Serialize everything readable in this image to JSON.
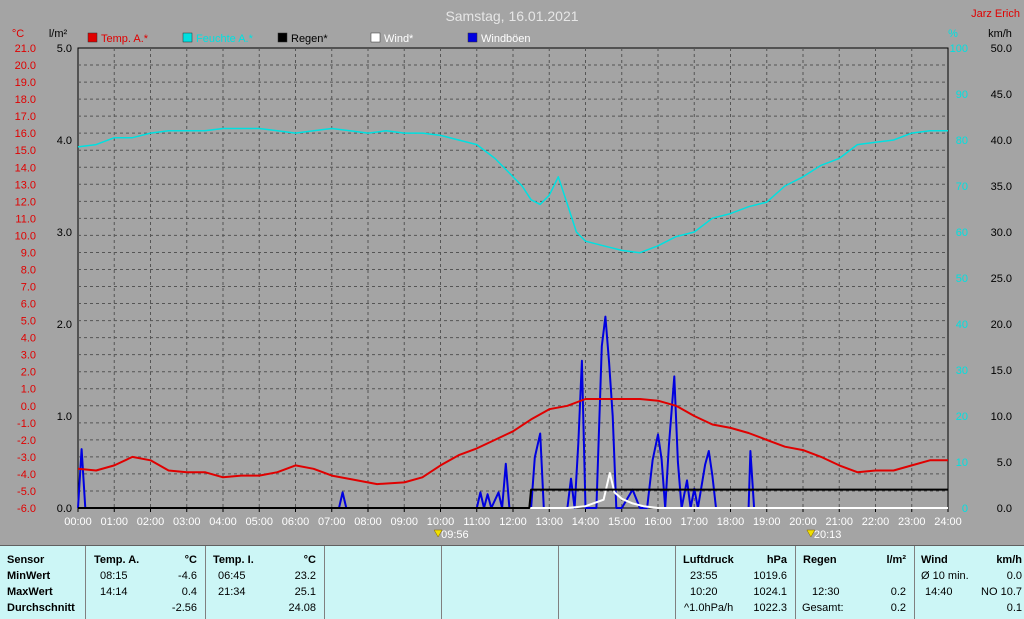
{
  "header": {
    "title": "Samstag, 16.01.2021",
    "station": "Jarz Erich"
  },
  "colors": {
    "temp": "#e00000",
    "humidity": "#00e0e0",
    "rain": "#000000",
    "wind": "#ffffff",
    "gusts": "#0000e0",
    "background": "#a4a4a4",
    "panel": "#ccf6f6"
  },
  "chart_data": {
    "type": "line",
    "legend": [
      "Temp. A.*",
      "Feuchte A.*",
      "Regen*",
      "Wind*",
      "Windböen"
    ],
    "units": {
      "left_temp": "°C",
      "left_rain": "l/m²",
      "right_hum": "%",
      "right_wind": "km/h"
    },
    "x_ticks": [
      "00:00",
      "01:00",
      "02:00",
      "03:00",
      "04:00",
      "05:00",
      "06:00",
      "07:00",
      "08:00",
      "09:00",
      "10:00",
      "11:00",
      "12:00",
      "13:00",
      "14:00",
      "15:00",
      "16:00",
      "17:00",
      "18:00",
      "19:00",
      "20:00",
      "21:00",
      "22:00",
      "23:00",
      "24:00"
    ],
    "temp_ticks": [
      "21.0",
      "20.0",
      "19.0",
      "18.0",
      "17.0",
      "16.0",
      "15.0",
      "14.0",
      "13.0",
      "12.0",
      "11.0",
      "10.0",
      "9.0",
      "8.0",
      "7.0",
      "6.0",
      "5.0",
      "4.0",
      "3.0",
      "2.0",
      "1.0",
      "0.0",
      "-1.0",
      "-2.0",
      "-3.0",
      "-4.0",
      "-5.0",
      "-6.0"
    ],
    "rain_ticks": [
      "5.0",
      "4.0",
      "3.0",
      "2.0",
      "1.0",
      "0.0"
    ],
    "hum_ticks": [
      "100",
      "90",
      "80",
      "70",
      "60",
      "50",
      "40",
      "30",
      "20",
      "10",
      "0"
    ],
    "wind_ticks": [
      "50.0",
      "45.0",
      "40.0",
      "35.0",
      "30.0",
      "25.0",
      "20.0",
      "15.0",
      "10.0",
      "5.0",
      "0.0"
    ],
    "sunrise": "09:56",
    "sunset": "20:13",
    "temp_range": [
      -6,
      21
    ],
    "rain_range": [
      0,
      5
    ],
    "hum_range": [
      0,
      100
    ],
    "wind_range": [
      0,
      50
    ],
    "temperature": [
      [
        0,
        -3.7
      ],
      [
        0.5,
        -3.8
      ],
      [
        1,
        -3.5
      ],
      [
        1.5,
        -3.0
      ],
      [
        2,
        -3.2
      ],
      [
        2.5,
        -3.8
      ],
      [
        3,
        -3.9
      ],
      [
        3.5,
        -3.9
      ],
      [
        4,
        -4.2
      ],
      [
        4.5,
        -4.1
      ],
      [
        5,
        -4.1
      ],
      [
        5.5,
        -3.9
      ],
      [
        6,
        -3.5
      ],
      [
        6.5,
        -3.7
      ],
      [
        7,
        -4.1
      ],
      [
        7.5,
        -4.3
      ],
      [
        8.25,
        -4.6
      ],
      [
        9,
        -4.5
      ],
      [
        9.5,
        -4.2
      ],
      [
        10,
        -3.5
      ],
      [
        10.5,
        -2.9
      ],
      [
        11,
        -2.5
      ],
      [
        11.5,
        -2.0
      ],
      [
        12,
        -1.5
      ],
      [
        12.5,
        -0.8
      ],
      [
        13,
        -0.2
      ],
      [
        13.5,
        0.0
      ],
      [
        14,
        0.4
      ],
      [
        14.25,
        0.4
      ],
      [
        15,
        0.4
      ],
      [
        15.5,
        0.4
      ],
      [
        16,
        0.3
      ],
      [
        16.5,
        0.0
      ],
      [
        17,
        -0.6
      ],
      [
        17.5,
        -1.1
      ],
      [
        18,
        -1.3
      ],
      [
        18.5,
        -1.6
      ],
      [
        19,
        -2.0
      ],
      [
        19.5,
        -2.4
      ],
      [
        20,
        -2.6
      ],
      [
        20.5,
        -3.0
      ],
      [
        21,
        -3.5
      ],
      [
        21.5,
        -3.9
      ],
      [
        22,
        -3.8
      ],
      [
        22.5,
        -3.8
      ],
      [
        23,
        -3.5
      ],
      [
        23.5,
        -3.2
      ],
      [
        24,
        -3.2
      ]
    ],
    "humidity": [
      [
        0,
        78.5
      ],
      [
        0.5,
        79
      ],
      [
        1,
        80.5
      ],
      [
        1.5,
        80.5
      ],
      [
        2,
        81.5
      ],
      [
        2.5,
        82
      ],
      [
        3,
        82
      ],
      [
        3.5,
        82
      ],
      [
        4,
        82.5
      ],
      [
        4.5,
        82.5
      ],
      [
        5,
        82.5
      ],
      [
        5.5,
        82
      ],
      [
        6,
        81.5
      ],
      [
        6.5,
        82
      ],
      [
        7,
        82.5
      ],
      [
        7.5,
        82
      ],
      [
        8,
        81.5
      ],
      [
        8.5,
        82
      ],
      [
        9,
        81.5
      ],
      [
        9.5,
        81.5
      ],
      [
        10,
        81
      ],
      [
        10.5,
        80
      ],
      [
        11,
        79
      ],
      [
        11.5,
        76
      ],
      [
        12,
        72
      ],
      [
        12.25,
        70
      ],
      [
        12.5,
        67
      ],
      [
        12.75,
        66
      ],
      [
        13,
        68
      ],
      [
        13.25,
        72
      ],
      [
        13.5,
        66
      ],
      [
        13.75,
        60
      ],
      [
        14,
        58
      ],
      [
        14.5,
        57
      ],
      [
        15,
        56
      ],
      [
        15.5,
        55.5
      ],
      [
        16,
        57
      ],
      [
        16.5,
        59
      ],
      [
        17,
        60
      ],
      [
        17.5,
        63
      ],
      [
        18,
        64
      ],
      [
        18.5,
        65.5
      ],
      [
        19,
        66.5
      ],
      [
        19.5,
        70
      ],
      [
        20,
        72
      ],
      [
        20.5,
        74.5
      ],
      [
        21,
        76
      ],
      [
        21.5,
        79
      ],
      [
        22,
        79.5
      ],
      [
        22.5,
        80
      ],
      [
        23,
        81.5
      ],
      [
        23.5,
        82
      ],
      [
        24,
        82
      ]
    ],
    "rain_total": [
      [
        0,
        0
      ],
      [
        12.45,
        0
      ],
      [
        12.5,
        0.2
      ],
      [
        12.7,
        0.2
      ],
      [
        13,
        0.2
      ],
      [
        24,
        0.2
      ]
    ],
    "wind_avg": [
      [
        0,
        0
      ],
      [
        13.5,
        0
      ],
      [
        14,
        0.2
      ],
      [
        14.5,
        0.9
      ],
      [
        14.67,
        3.8
      ],
      [
        14.8,
        1.7
      ],
      [
        15,
        1.0
      ],
      [
        15.3,
        0.5
      ],
      [
        15.6,
        0.2
      ],
      [
        16,
        0
      ],
      [
        24,
        0
      ]
    ],
    "gusts": [
      [
        0,
        0
      ],
      [
        0.1,
        6.4
      ],
      [
        0.2,
        0
      ],
      [
        7.2,
        0
      ],
      [
        7.3,
        1.7
      ],
      [
        7.4,
        0
      ],
      [
        11,
        0
      ],
      [
        11.1,
        1.7
      ],
      [
        11.2,
        0
      ],
      [
        11.3,
        1.5
      ],
      [
        11.4,
        0
      ],
      [
        11.6,
        1.7
      ],
      [
        11.7,
        0
      ],
      [
        11.8,
        4.8
      ],
      [
        11.9,
        0
      ],
      [
        12.5,
        0
      ],
      [
        12.6,
        5.5
      ],
      [
        12.75,
        8.1
      ],
      [
        12.85,
        0
      ],
      [
        13.5,
        0
      ],
      [
        13.6,
        3.2
      ],
      [
        13.7,
        0
      ],
      [
        13.8,
        7.0
      ],
      [
        13.9,
        16.0
      ],
      [
        14,
        0
      ],
      [
        14.3,
        0
      ],
      [
        14.45,
        17.6
      ],
      [
        14.55,
        20.8
      ],
      [
        14.65,
        15.8
      ],
      [
        14.75,
        10.0
      ],
      [
        14.85,
        0
      ],
      [
        15,
        0
      ],
      [
        15.3,
        2.0
      ],
      [
        15.5,
        0
      ],
      [
        15.7,
        0
      ],
      [
        15.85,
        5.2
      ],
      [
        16,
        8.0
      ],
      [
        16.1,
        5.3
      ],
      [
        16.2,
        0
      ],
      [
        16.3,
        6.8
      ],
      [
        16.45,
        14.3
      ],
      [
        16.55,
        5.0
      ],
      [
        16.65,
        0
      ],
      [
        16.8,
        3.0
      ],
      [
        16.9,
        0
      ],
      [
        17,
        2.1
      ],
      [
        17.1,
        0
      ],
      [
        17.3,
        4.7
      ],
      [
        17.4,
        6.2
      ],
      [
        17.5,
        3.5
      ],
      [
        17.6,
        0
      ],
      [
        18.5,
        0
      ],
      [
        18.55,
        6.2
      ],
      [
        18.65,
        0
      ],
      [
        24,
        0
      ]
    ]
  },
  "stats": {
    "sensor": {
      "header": "Sensor",
      "rows": [
        "MinWert",
        "MaxWert",
        "Durchschnitt"
      ]
    },
    "temp_a": {
      "header": "Temp. A.",
      "unit": "°C",
      "min_time": "08:15",
      "min": "-4.6",
      "max_time": "14:14",
      "max": "0.4",
      "avg": "-2.56"
    },
    "temp_i": {
      "header": "Temp. I.",
      "unit": "°C",
      "min_time": "06:45",
      "min": "23.2",
      "max_time": "21:34",
      "max": "25.1",
      "avg": "24.08"
    },
    "pressure": {
      "header": "Luftdruck",
      "unit": "hPa",
      "min_time": "23:55",
      "min": "1019.6",
      "max_time": "10:20",
      "max": "1024.1",
      "avg_label": "^1.0hPa/h",
      "avg": "1022.3"
    },
    "rain": {
      "header": "Regen",
      "unit": "l/m²",
      "max_time": "12:30",
      "max": "0.2",
      "total_label": "Gesamt:",
      "total": "0.2"
    },
    "wind": {
      "header": "Wind",
      "unit": "km/h",
      "avg_label": "Ø 10 min.",
      "avg": "0.0",
      "max_time": "14:40",
      "max": "NO 10.7",
      "mean": "0.1"
    }
  }
}
